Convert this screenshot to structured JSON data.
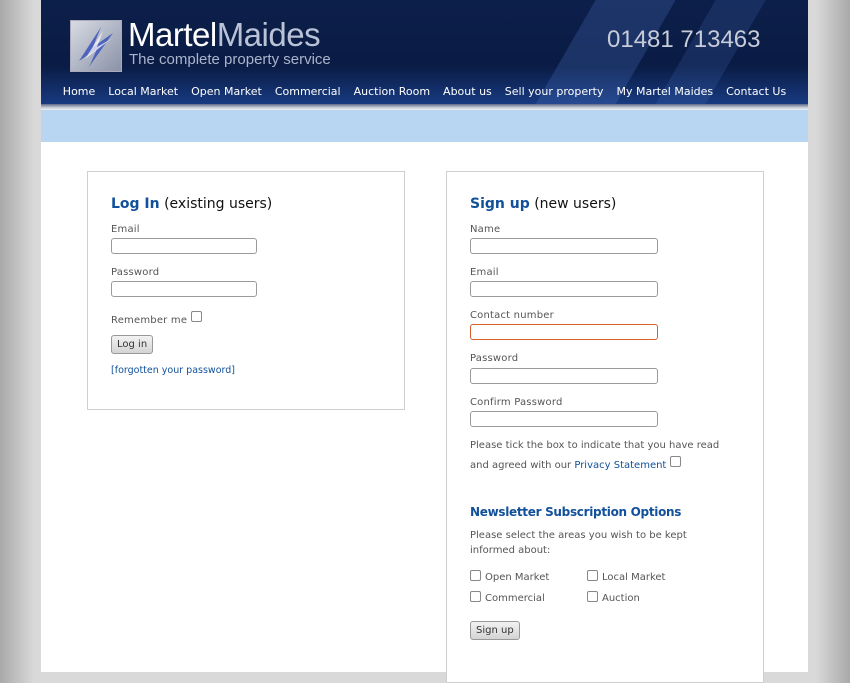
{
  "header": {
    "brand_part1": "Martel",
    "brand_part2": "Maides",
    "tagline": "The complete property service",
    "phone": "01481 713463",
    "nav": [
      "Home",
      "Local Market",
      "Open Market",
      "Commercial",
      "Auction Room",
      "About us",
      "Sell your property",
      "My Martel Maides",
      "Contact Us"
    ]
  },
  "login": {
    "title": "Log In",
    "title_suffix": "(existing users)",
    "email_label": "Email",
    "password_label": "Password",
    "remember_label": "Remember me",
    "button": "Log in",
    "forgot_open": "[",
    "forgot_link": "forgotten your password",
    "forgot_close": "]"
  },
  "signup": {
    "title": "Sign up",
    "title_suffix": "(new users)",
    "name_label": "Name",
    "email_label": "Email",
    "contact_label": "Contact number",
    "password_label": "Password",
    "confirm_label": "Confirm Password",
    "privacy_line1": "Please tick the box to indicate that you have read",
    "privacy_line2": "and agreed with our",
    "privacy_link": "Privacy Statement",
    "newsletter_title": "Newsletter Subscription Options",
    "newsletter_line1": "Please select the areas you wish to be kept",
    "newsletter_line2": "informed about:",
    "options": [
      "Open Market",
      "Local Market",
      "Commercial",
      "Auction"
    ],
    "button": "Sign up"
  },
  "colors": {
    "header_bg": "#0c1f4a",
    "accent_blue": "#11509a",
    "band_blue": "#b8d5f1",
    "error_border": "#d2602a"
  }
}
